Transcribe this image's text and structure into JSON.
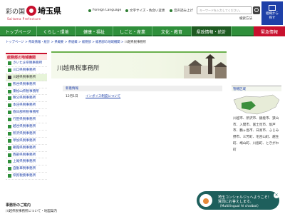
{
  "header": {
    "logo_left": "彩の国",
    "logo_right": "埼玉県",
    "logo_sub": "Saitama Prefecture",
    "foreign": "Foreign Language",
    "fontsize": "文字サイズ・色合い変更",
    "voice": "音声読み上げ",
    "search_placeholder": "キーワードを入力してください。",
    "kensaku": "検索方法",
    "org_label_1": "組織から",
    "org_label_2": "探す"
  },
  "nav": [
    "トップページ",
    "くらし・環境",
    "健康・福祉",
    "しごと・産業",
    "文化・教育",
    "県政情報・統計",
    "緊急情報"
  ],
  "breadcrumb": [
    "トップページ",
    "県政情報・統計",
    "県概要",
    "県組織",
    "総務部",
    "総務部の地域機関",
    "川越県税事務所"
  ],
  "sidebar": {
    "title": "総務部の地域機関",
    "items": [
      "さいたま県税事務所",
      "川口県税事務所",
      "川越県税事務所",
      "熊谷県税事務所",
      "東松山県税事務所",
      "秩父県税事務所",
      "本庄県税事務所",
      "春日部県税事務所",
      "行田県税事務所",
      "越谷県税事務所",
      "所沢県税事務所",
      "草加県税事務所",
      "朝霞県税事務所",
      "西部県税事務所",
      "上尾県税事務所",
      "自動車税事務所",
      "県民税務事務所"
    ],
    "current_index": 2,
    "footer_title": "事務所のご案内",
    "footer_text": "川越県税事務所について・地図案内"
  },
  "main": {
    "title": "川越県税事務所",
    "news_head": "新着情報",
    "news_date": "12月1日",
    "news_link": "インボイス制度について"
  },
  "right": {
    "head": "管轄区域",
    "desc": "川越市、所沢市、飯能市、狭山市、入間市、富士見市、坂戸市、鶴ヶ島市、日高市、ふじみ野市、三芳町、毛呂山町、越生町、鳩山町、川島町、ときがわ町"
  },
  "chat": {
    "line1": "埼玉コンシェルジュへようこそ！",
    "line2": "質問にお答えします。",
    "line3": "（Multilingual AI chatbot）",
    "close": "×"
  },
  "colors": {
    "green": "#2f8f3b",
    "red": "#c8102e",
    "blue": "#1e40a8"
  }
}
